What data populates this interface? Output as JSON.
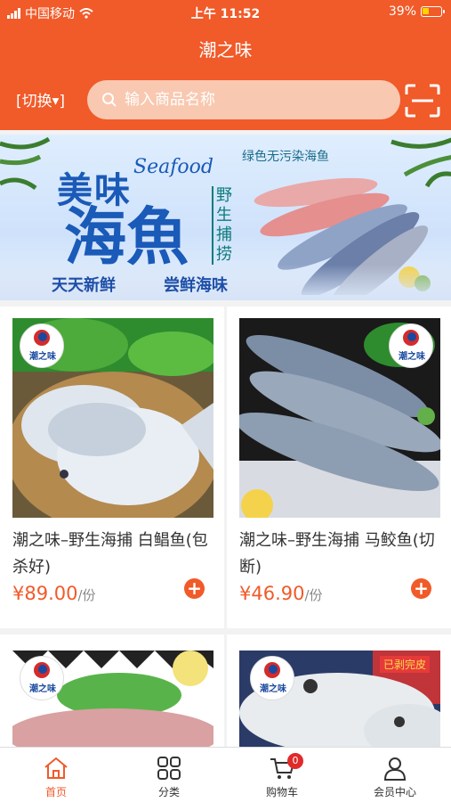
{
  "status_bar": {
    "carrier": "中国移动",
    "time": "上午 11:52",
    "battery_percent": "39%",
    "battery_level": 0.39
  },
  "header": {
    "title": "潮之味",
    "switch_label": "[切换",
    "search_placeholder": "输入商品名称"
  },
  "banner": {
    "title_a": "美味",
    "title_seafood": "Seafood",
    "title_b": "海魚",
    "vertical_text": "野生捕捞",
    "tag": "绿色无污染海鱼",
    "slogan_1": "天天新鲜",
    "slogan_2": "尝鲜海味"
  },
  "brand_logo_text": "潮之味",
  "products": [
    {
      "name": "潮之味–野生海捕 白鲳鱼(包杀好)",
      "price": "¥89.00",
      "unit": "/份"
    },
    {
      "name": "潮之味–野生海捕 马鲛鱼(切断)",
      "price": "¥46.90",
      "unit": "/份"
    },
    {
      "name": "",
      "price": "",
      "unit": ""
    },
    {
      "name": "",
      "price": "",
      "unit": "",
      "tag": "已剥完皮"
    }
  ],
  "tabbar": {
    "items": [
      {
        "label": "首页",
        "icon": "home-icon",
        "active": true
      },
      {
        "label": "分类",
        "icon": "grid-icon",
        "active": false
      },
      {
        "label": "购物车",
        "icon": "cart-icon",
        "active": false,
        "badge": "0"
      },
      {
        "label": "会员中心",
        "icon": "user-icon",
        "active": false
      }
    ]
  },
  "colors": {
    "accent": "#f15a29",
    "search_bg": "#f9c8b0",
    "badge": "#e02a2a"
  }
}
